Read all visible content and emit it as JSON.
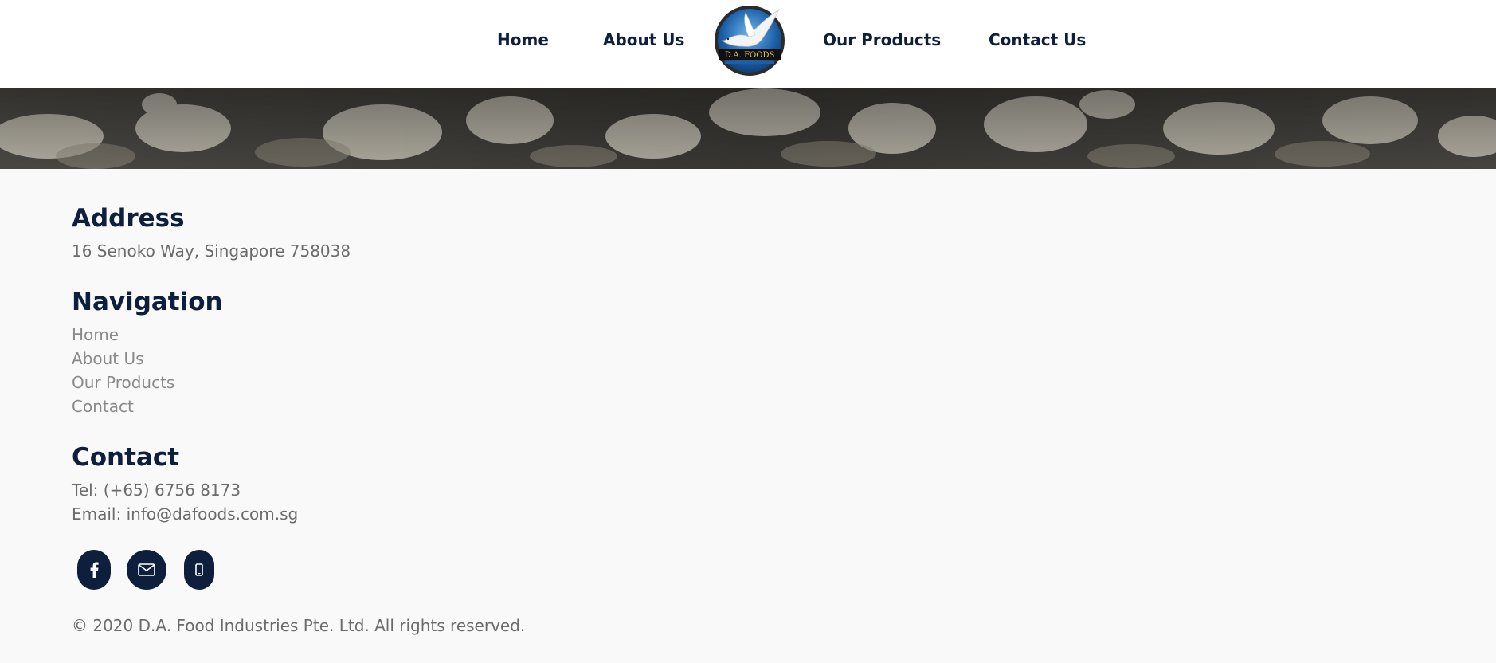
{
  "header": {
    "nav": [
      {
        "label": "Home"
      },
      {
        "label": "About Us"
      },
      {
        "label": "Our Products"
      },
      {
        "label": "Contact Us"
      }
    ],
    "logo_text": "D.A. FOODS"
  },
  "footer": {
    "address": {
      "heading": "Address",
      "line": "16 Senoko Way, Singapore 758038"
    },
    "navigation": {
      "heading": "Navigation",
      "links": [
        {
          "label": "Home"
        },
        {
          "label": "About Us"
        },
        {
          "label": "Our Products"
        },
        {
          "label": "Contact"
        }
      ]
    },
    "contact": {
      "heading": "Contact",
      "tel": "Tel: (+65) 6756 8173",
      "email": "Email: info@dafoods.com.sg"
    },
    "social": [
      {
        "icon": "facebook-icon"
      },
      {
        "icon": "envelope-icon"
      },
      {
        "icon": "mobile-phone-icon"
      }
    ],
    "copyright": "© 2020 D.A. Food Industries Pte. Ltd. All rights reserved."
  },
  "colors": {
    "brand_navy": "#0d1f3c",
    "text_grey": "#6b6b6b",
    "link_grey": "#8a8a8a",
    "footer_bg": "#f9f9f9"
  }
}
